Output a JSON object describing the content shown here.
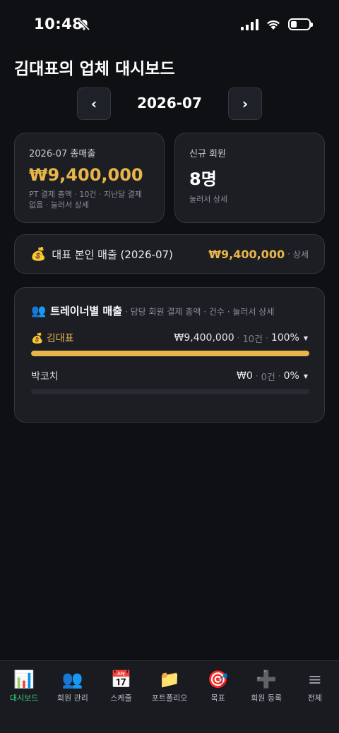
{
  "status_bar": {
    "time": "10:48"
  },
  "page": {
    "title": "김대표의 업체 대시보드"
  },
  "month_nav": {
    "prev": "‹",
    "current": "2026-07",
    "next": "›"
  },
  "revenue_card": {
    "label": "2026-07 총매출",
    "amount": "₩9,400,000",
    "sub": "PT 결제 총액 · 10건 · 지난달 결제 없음 · 눌러서 상세"
  },
  "members_card": {
    "label": "신규 회원",
    "value": "8명",
    "sub": "눌러서 상세"
  },
  "owner_card": {
    "icon": "💰",
    "label": "대표 본인 매출 (2026-07)",
    "amount": "₩9,400,000",
    "detail": "상세"
  },
  "trainer_card": {
    "icon": "👥",
    "title": "트레이너별 매출",
    "sub": "· 담당 회원 결제 총액 · 건수 · 눌러서 상세",
    "trainers": [
      {
        "icon": "💰",
        "name": "김대표",
        "amount": "₩9,400,000",
        "count": "10건",
        "percent": "100%",
        "share": 1.0,
        "highlight": true
      },
      {
        "icon": "",
        "name": "박코치",
        "amount": "₩0",
        "count": "0건",
        "percent": "0%",
        "share": 0.0,
        "highlight": false
      }
    ]
  },
  "tabs": [
    {
      "icon": "📊",
      "label": "대시보드",
      "active": true
    },
    {
      "icon": "👥",
      "label": "회원 관리",
      "active": false
    },
    {
      "icon": "📅",
      "label": "스케줄",
      "active": false
    },
    {
      "icon": "📁",
      "label": "포트폴리오",
      "active": false
    },
    {
      "icon": "🎯",
      "label": "목표",
      "active": false
    },
    {
      "icon": "➕",
      "label": "회원 등록",
      "active": false
    },
    {
      "icon": "≡",
      "label": "전체",
      "active": false
    }
  ],
  "colors": {
    "accent_gold": "#e8b54a",
    "accent_green": "#3bd17f",
    "background": "#0f1014",
    "card": "#1c1e24"
  }
}
